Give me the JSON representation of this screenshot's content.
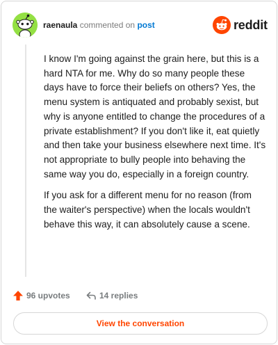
{
  "header": {
    "username": "raenaula",
    "verb": "commented on",
    "target": "post",
    "brand": "reddit"
  },
  "comment": {
    "paragraphs": [
      "I know I'm going against the grain here, but this is a hard NTA for me. Why do so many people these days have to force their beliefs on others? Yes, the menu system is antiquated and probably sexist, but why is anyone entitled to change the procedures of a private establishment? If you don't like it, eat quietly and then take your business elsewhere next time. It's not appropriate to bully people into behaving the same way you do, especially in a foreign country.",
      "If you ask for a different menu for no reason (from the waiter's perspective) when the locals wouldn't behave this way, it can absolutely cause a scene."
    ]
  },
  "stats": {
    "upvotes": "96 upvotes",
    "replies": "14 replies"
  },
  "cta": {
    "label": "View the conversation"
  },
  "colors": {
    "brand_orange": "#ff4500",
    "link_blue": "#0079d3",
    "avatar_green": "#94e044",
    "muted_gray": "#787c7e"
  },
  "icons": {
    "avatar": "snoo-avatar-icon",
    "brand": "reddit-logo-icon",
    "upvotes": "upvote-arrow-icon",
    "replies": "reply-arrow-icon"
  }
}
